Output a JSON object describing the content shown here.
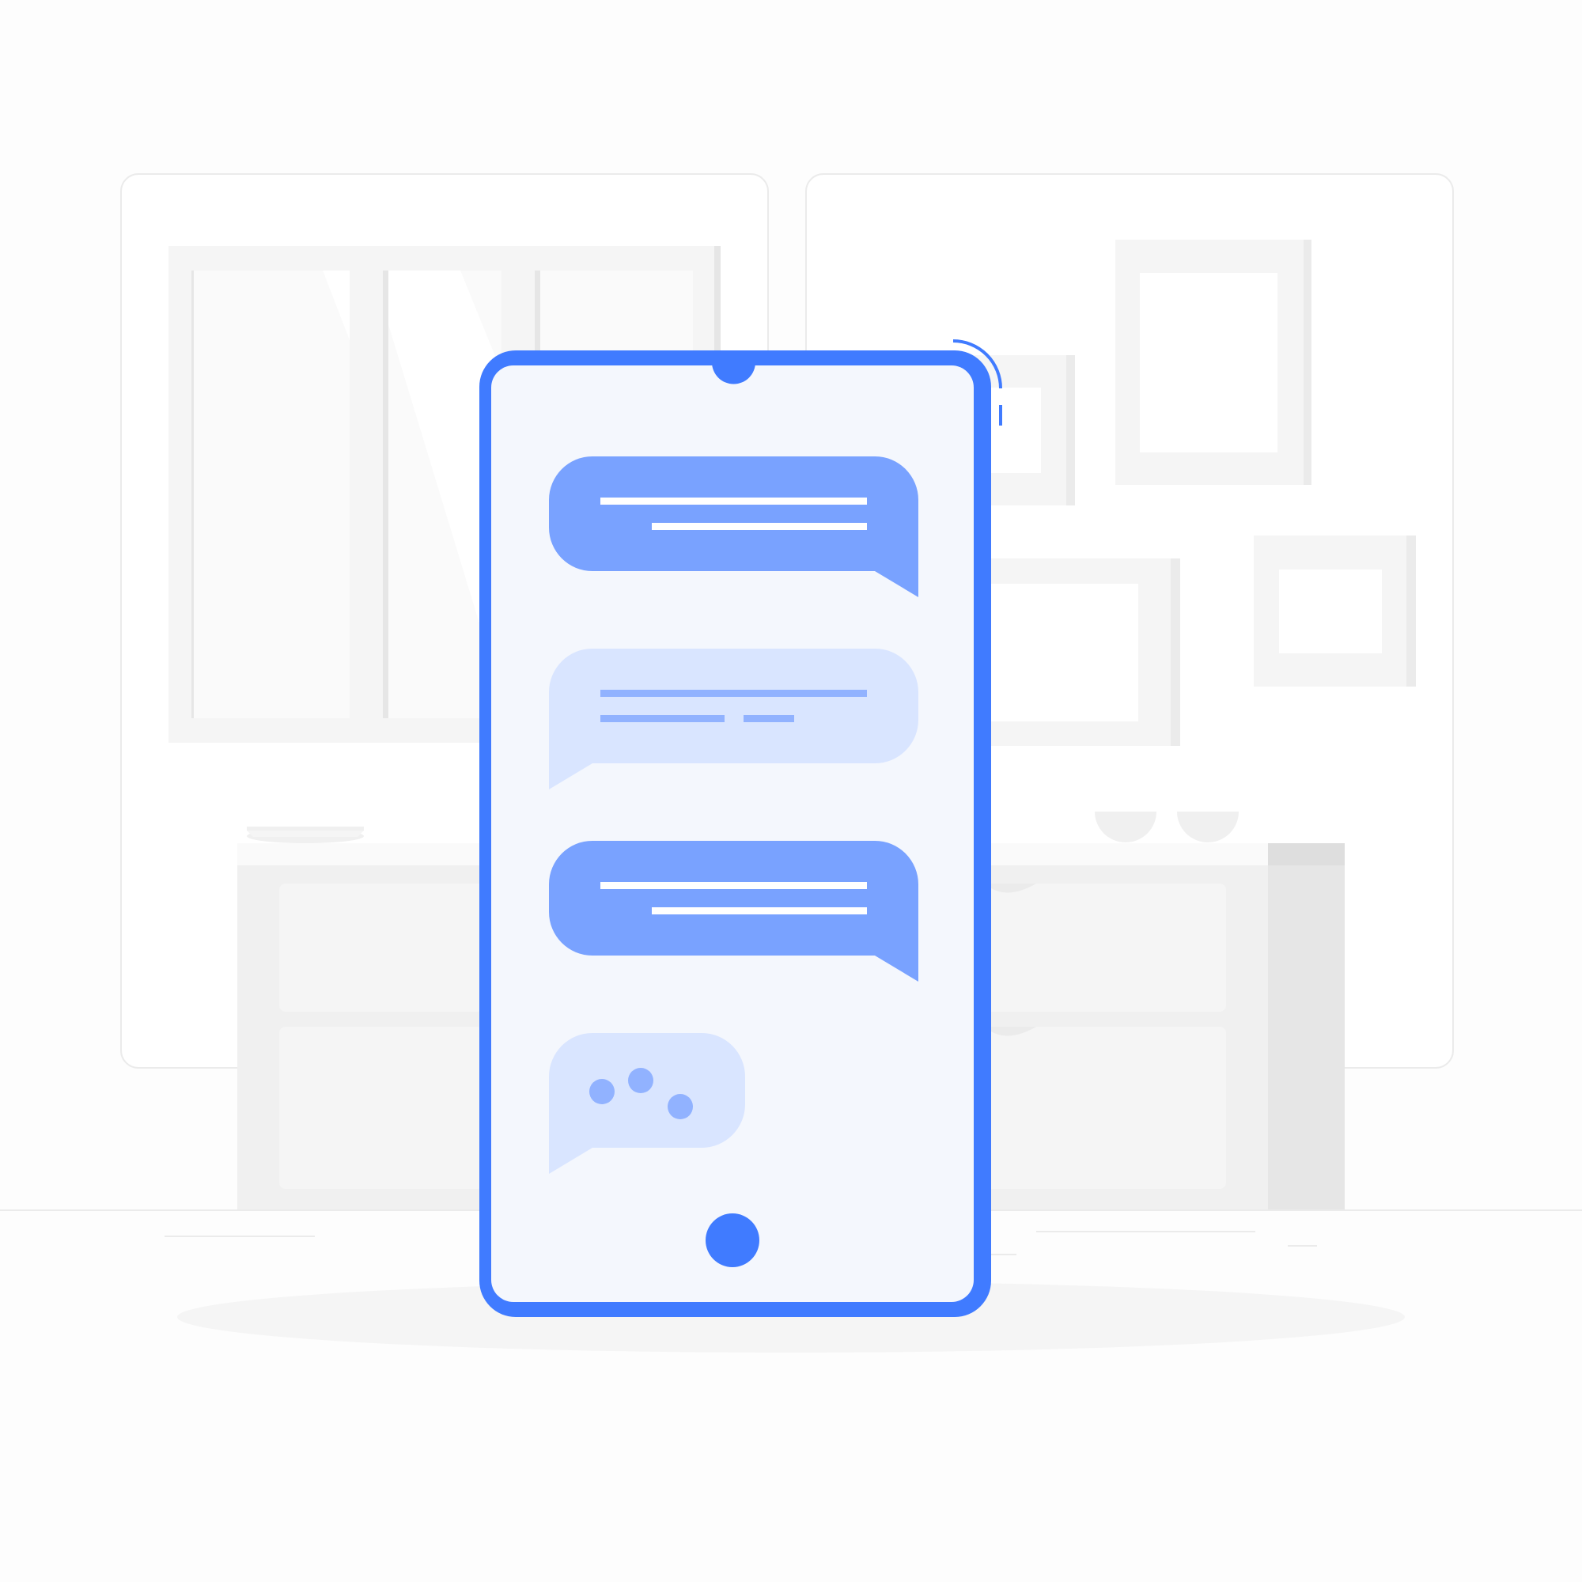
{
  "palette": {
    "background": "#fdfdfd",
    "accent": "#407bff",
    "bubble_dark": "#79a2ff",
    "bubble_light": "#d9e5ff",
    "bubble_light_lines": "#91b2ff",
    "screen": "#f4f7fd",
    "furniture_light": "#f5f5f5",
    "furniture_mid": "#f0f0f0",
    "furniture_dark": "#e6e6e6",
    "outline": "#ebebeb"
  },
  "phone": {
    "icons": [
      "camera-notch-icon",
      "home-button-icon",
      "vibration-signal-icon"
    ]
  },
  "chat": {
    "messages": [
      {
        "side": "right",
        "style": "dark",
        "line_count": 2
      },
      {
        "side": "left",
        "style": "light",
        "line_count": 2
      },
      {
        "side": "right",
        "style": "dark",
        "line_count": 2
      },
      {
        "side": "left",
        "style": "light",
        "typing_indicator": true
      }
    ]
  }
}
